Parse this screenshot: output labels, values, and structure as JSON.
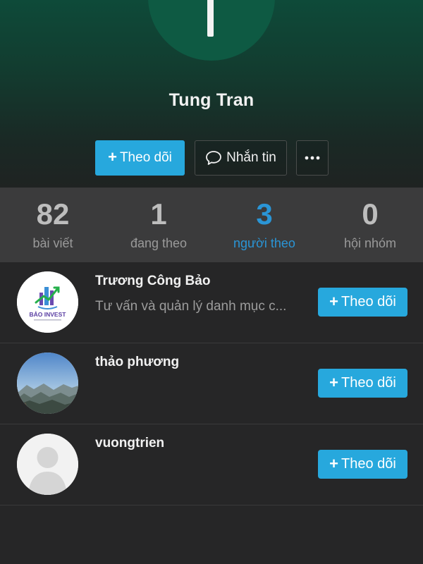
{
  "profile": {
    "name": "Tung Tran",
    "avatar_initial_icon": "letter-t-avatar"
  },
  "actions": {
    "follow_label": "Theo dõi",
    "message_label": "Nhắn tin",
    "more_icon": "ellipsis-icon"
  },
  "stats": [
    {
      "value": "82",
      "label": "bài viết",
      "active": false
    },
    {
      "value": "1",
      "label": "đang theo",
      "active": false
    },
    {
      "value": "3",
      "label": "người theo",
      "active": true
    },
    {
      "value": "0",
      "label": "hội nhóm",
      "active": false
    }
  ],
  "followers": [
    {
      "name": "Trương Công Bảo",
      "subtitle": "Tư vấn và quản lý danh mục c...",
      "avatar_text": "BẢO INVEST",
      "follow_label": "Theo dõi"
    },
    {
      "name": "thảo phương",
      "subtitle": "",
      "avatar": "landscape-photo",
      "follow_label": "Theo dõi"
    },
    {
      "name": "vuongtrien",
      "subtitle": "",
      "avatar": "default-person-silhouette",
      "follow_label": "Theo dõi"
    }
  ],
  "colors": {
    "accent": "#27a8dd",
    "active_stat": "#2a95d6",
    "header_top": "#0e4a39",
    "background": "#262627"
  }
}
